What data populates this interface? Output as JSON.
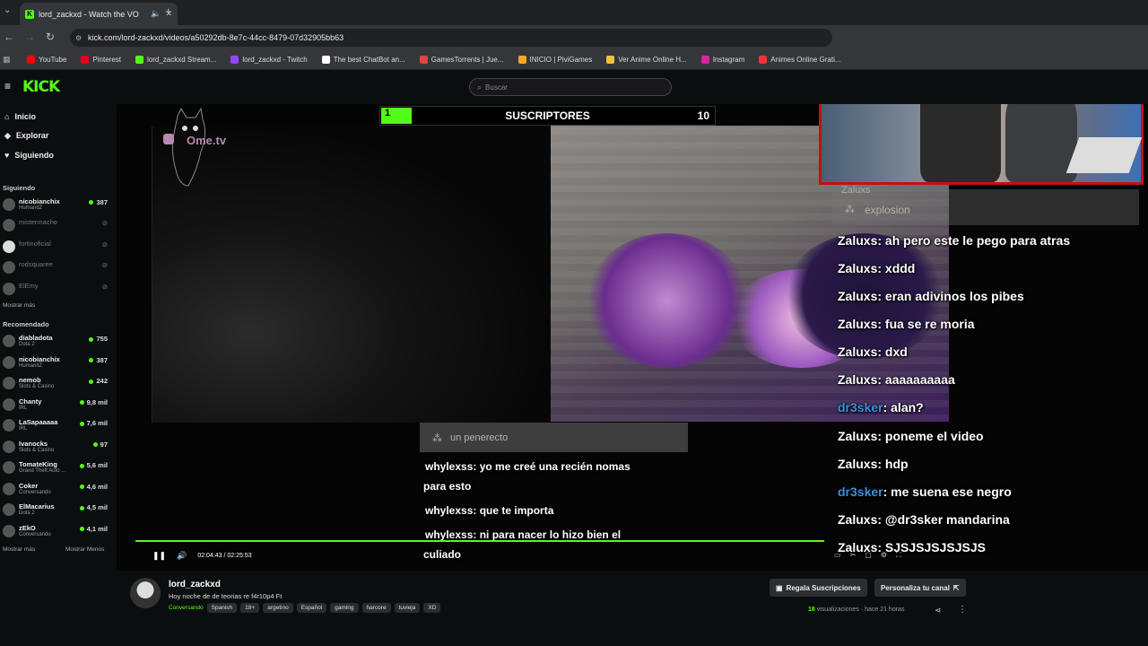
{
  "browser": {
    "tab_title": "lord_zackxd - Watch the VO",
    "url": "kick.com/lord-zackxd/videos/a50292db-8e7c-44cc-8479-07d32905bb63",
    "bookmarks": [
      {
        "label": "YouTube",
        "color": "#ff0000"
      },
      {
        "label": "Pinterest",
        "color": "#e60023"
      },
      {
        "label": "lord_zackxd Stream...",
        "color": "#53fc18"
      },
      {
        "label": "lord_zackxd - Twitch",
        "color": "#9146ff"
      },
      {
        "label": "The best ChatBot an...",
        "color": "#ffffff"
      },
      {
        "label": "GamesTorrents | Jue...",
        "color": "#d44"
      },
      {
        "label": "INICIO | PiviGames",
        "color": "#f5a623"
      },
      {
        "label": "Ver Anime Online H...",
        "color": "#f0c040"
      },
      {
        "label": "Instagram",
        "color": "#d6249f"
      },
      {
        "label": "Animes Online Grati...",
        "color": "#e33"
      }
    ]
  },
  "header": {
    "logo": "KICK",
    "search_placeholder": "Buscar"
  },
  "sidebar": {
    "nav": [
      {
        "label": "Inicio",
        "icon": "home-icon"
      },
      {
        "label": "Explorar",
        "icon": "compass-icon"
      },
      {
        "label": "Siguiendo",
        "icon": "heart-icon"
      }
    ],
    "following_title": "Siguiendo",
    "following": [
      {
        "name": "nicobianchix",
        "cat": "HumanitZ",
        "viewers": "387",
        "online": true
      },
      {
        "name": "mistermacho",
        "cat": "",
        "viewers": "",
        "online": false
      },
      {
        "name": "fortinoficial",
        "cat": "",
        "viewers": "",
        "online": false
      },
      {
        "name": "rodsquaree",
        "cat": "",
        "viewers": "",
        "online": false
      },
      {
        "name": "ElEmy",
        "cat": "",
        "viewers": "",
        "online": false
      }
    ],
    "show_more": "Mostrar más",
    "recommended_title": "Recomendado",
    "recommended": [
      {
        "name": "diabladota",
        "cat": "Dota 2",
        "viewers": "755"
      },
      {
        "name": "nicobianchix",
        "cat": "HumanitZ",
        "viewers": "387"
      },
      {
        "name": "nemob",
        "cat": "Slots & Casino",
        "viewers": "242"
      },
      {
        "name": "Chanty",
        "cat": "IRL",
        "viewers": "9,8 mil"
      },
      {
        "name": "LaSapaaaaa",
        "cat": "IRL",
        "viewers": "7,6 mil"
      },
      {
        "name": "Ivanocks",
        "cat": "Slots & Casino",
        "viewers": "97"
      },
      {
        "name": "TomateKing",
        "cat": "Grand Theft Auto ...",
        "viewers": "5,6 mil"
      },
      {
        "name": "Coker",
        "cat": "Conversando",
        "viewers": "4,6 mil"
      },
      {
        "name": "ElMacarius",
        "cat": "Dota 2",
        "viewers": "4,5 mil"
      },
      {
        "name": "zEkO",
        "cat": "Conversando",
        "viewers": "4,1 mil"
      }
    ],
    "show_more2": "Mostrar más",
    "show_less": "Mostrar Menos"
  },
  "video": {
    "sub_goal": {
      "current": "1",
      "label": "SUSCRIPTORES",
      "target": "10"
    },
    "ometv": "Ome.tv",
    "highlight_left": {
      "text": "un penerecto"
    },
    "chat_left": [
      {
        "user": "whylexss",
        "msg": ": yo me creé una recién nomas"
      },
      {
        "user": "",
        "msg": "para esto"
      },
      {
        "user": "whylexss",
        "msg": ": que te importa"
      },
      {
        "user": "whylexss",
        "msg": ": ni para nacer lo hizo bien el"
      },
      {
        "user": "",
        "msg": "culiado"
      }
    ],
    "highlight_right": {
      "user": "Zaluxs",
      "text": "explosion"
    },
    "chat_right": [
      {
        "user": "Zaluxs",
        "msg": ": ah pero este le pego para atras",
        "blue": false
      },
      {
        "user": "Zaluxs",
        "msg": ": xddd",
        "blue": false
      },
      {
        "user": "Zaluxs",
        "msg": ": eran adivinos los pibes",
        "blue": false
      },
      {
        "user": "Zaluxs",
        "msg": ": fua se re moria",
        "blue": false
      },
      {
        "user": "Zaluxs",
        "msg": ": dxd",
        "blue": false
      },
      {
        "user": "Zaluxs",
        "msg": ": aaaaaaaaaa",
        "blue": false
      },
      {
        "user": "dr3sker",
        "msg": ": alan?",
        "blue": true
      },
      {
        "user": "Zaluxs",
        "msg": ": poneme el video",
        "blue": false
      },
      {
        "user": "Zaluxs",
        "msg": ": hdp",
        "blue": false
      },
      {
        "user": "dr3sker",
        "msg": ": me suena ese negro",
        "blue": true
      },
      {
        "user": "Zaluxs",
        "msg": ": @dr3sker mandarina",
        "blue": false
      },
      {
        "user": "Zaluxs",
        "msg": ": SJSJSJSJSJSJS",
        "blue": false
      }
    ],
    "time": "02:04:43 / 02:25:53",
    "progress": 0.857
  },
  "info": {
    "streamer": "lord_zackxd",
    "title": "Hoy noche de  de teorias re f4r10p4 Ft",
    "category": "Conversando",
    "tags": [
      "Spanish",
      "18+",
      "argetino",
      "Español",
      "gaming",
      "harcore",
      "tuvieja",
      "XD"
    ],
    "gift_button": "Regala Suscripciones",
    "customize_button": "Personaliza tu canal",
    "views_count": "18",
    "views_label": "visualizaciones",
    "ago": "hace 21 horas"
  },
  "colors": {
    "accent": "#53fc18",
    "username_blue": "#3b8fe0",
    "facecam_border": "#c31111"
  }
}
